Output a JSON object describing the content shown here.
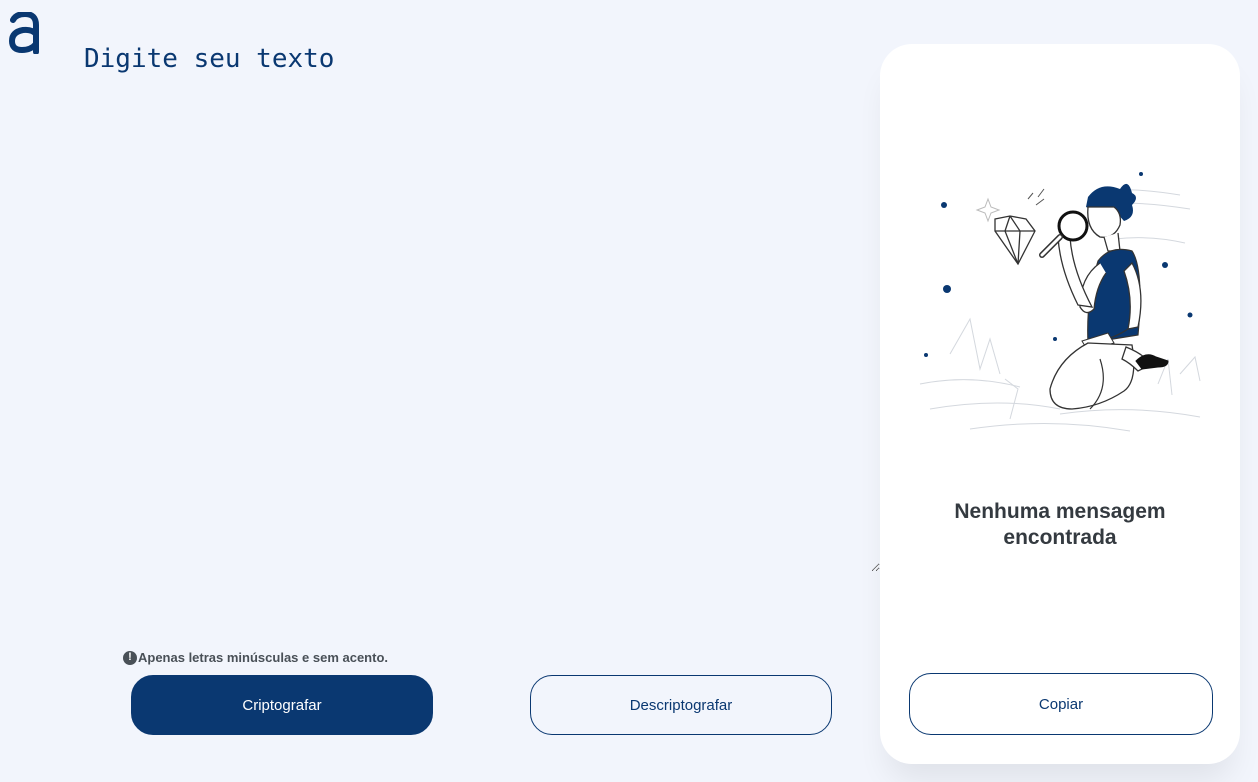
{
  "logo": {
    "icon": "alura-logo-icon",
    "color": "#0a3871"
  },
  "input": {
    "placeholder": "Digite seu texto",
    "value": ""
  },
  "warning": {
    "icon": "exclamation-circle-icon",
    "text": "Apenas letras minúsculas e sem acento."
  },
  "actions": {
    "encrypt_label": "Criptografar",
    "decrypt_label": "Descriptografar"
  },
  "output": {
    "empty_title": "Nenhuma mensagem encontrada",
    "illustration": "person-with-magnifying-glass-illustration",
    "copy_label": "Copiar"
  },
  "colors": {
    "background": "#f2f5fc",
    "primary": "#0a3871",
    "panel": "#ffffff",
    "text_dark": "#343a40",
    "text_muted": "#495057"
  }
}
